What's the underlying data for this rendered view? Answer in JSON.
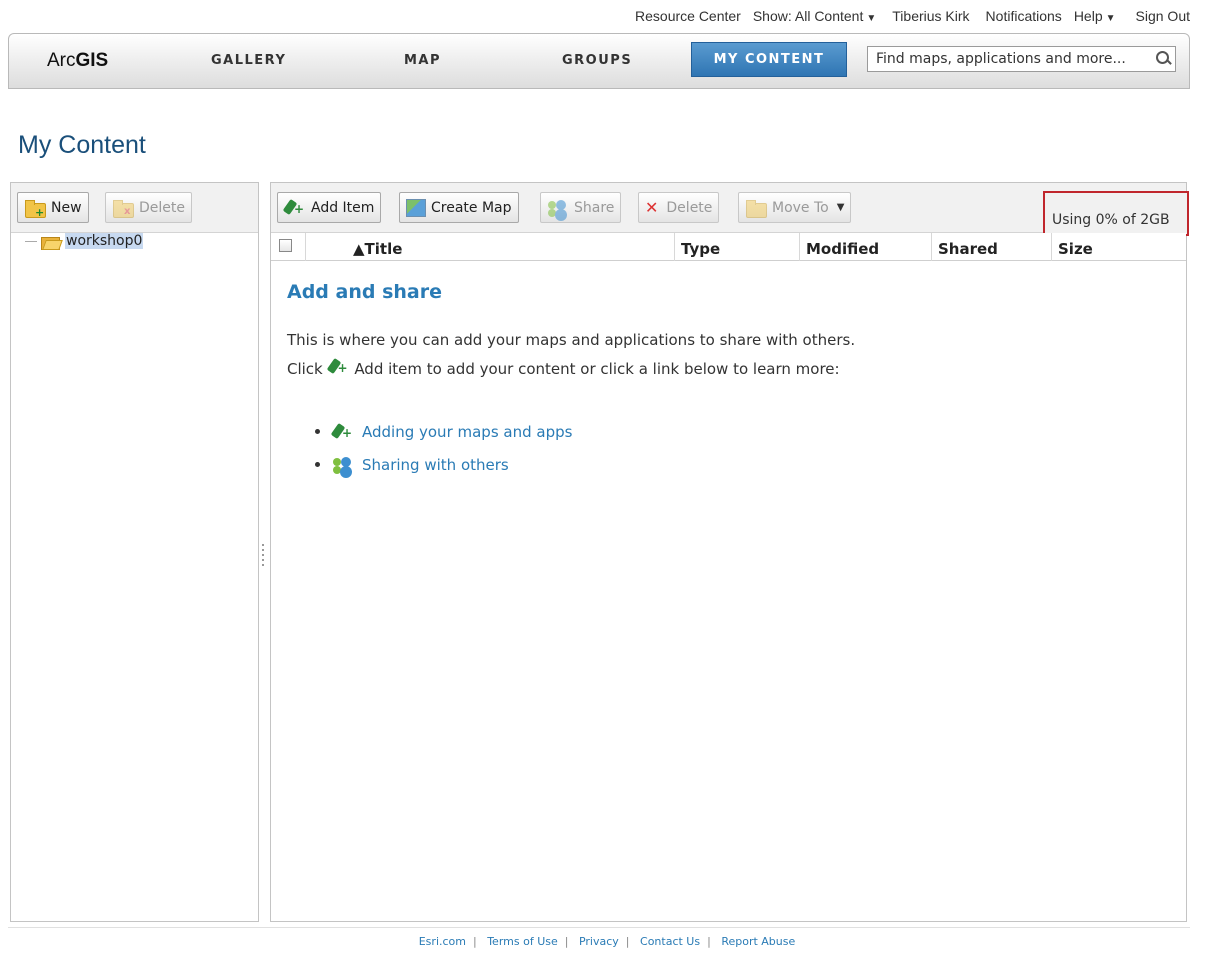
{
  "toplinks": {
    "resource_center": "Resource Center",
    "show": "Show: All Content",
    "user": "Tiberius Kirk",
    "notifications": "Notifications",
    "help": "Help",
    "sign_out": "Sign Out",
    "caret": "▼"
  },
  "nav": {
    "logo_prefix": "Arc",
    "logo_bold": "GIS",
    "gallery": "GALLERY",
    "map": "MAP",
    "groups": "GROUPS",
    "my_content": "MY CONTENT",
    "search_placeholder": "Find maps, applications and more..."
  },
  "page_title": "My Content",
  "left": {
    "new_label": "New",
    "delete_label": "Delete",
    "folder": "workshop0"
  },
  "right": {
    "add_item": "Add Item",
    "create_map": "Create Map",
    "share": "Share",
    "delete": "Delete",
    "move_to": "Move To",
    "usage": "Using 0% of 2GB",
    "columns": {
      "title": "▲Title",
      "type": "Type",
      "modified": "Modified",
      "shared": "Shared",
      "size": "Size"
    },
    "heading": "Add and share",
    "line1": "This is where you can add your maps and applications to share with others.",
    "line2_pre": "Click",
    "line2_post": "Add item to add your content or click a link below to learn more:",
    "links": [
      {
        "label": "Adding your maps and apps",
        "icon": "add-item-icon"
      },
      {
        "label": "Sharing with others",
        "icon": "share-people-icon"
      }
    ]
  },
  "footer": {
    "links": [
      "Esri.com",
      "Terms of Use",
      "Privacy",
      "Contact Us",
      "Report Abuse"
    ],
    "separator": "|"
  },
  "colors": {
    "accent": "#2f75b3",
    "link": "#2a7bb5",
    "highlight_box": "#c0262c"
  }
}
